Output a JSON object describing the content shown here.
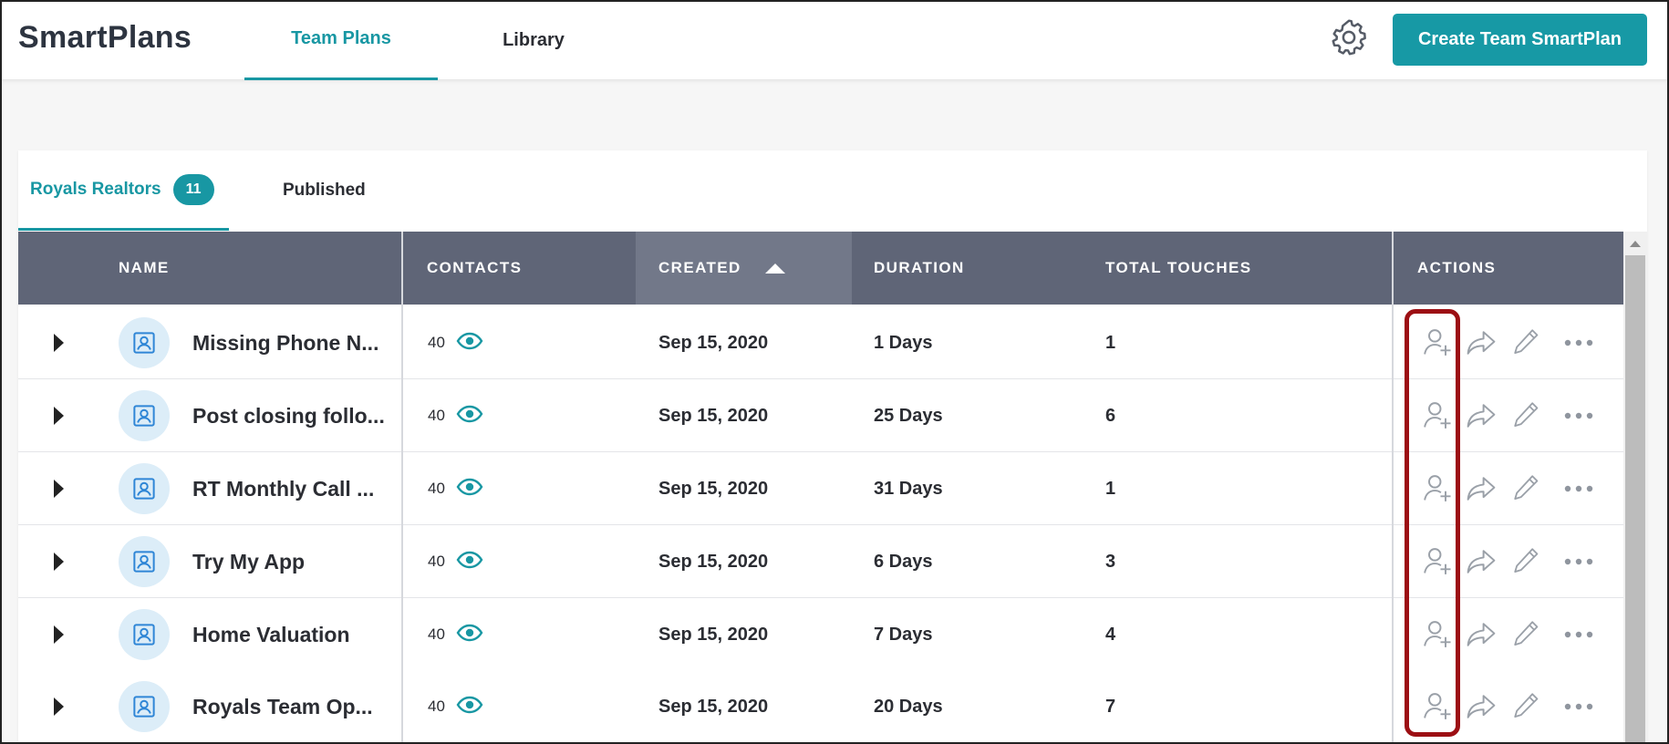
{
  "app": {
    "title": "SmartPlans"
  },
  "nav": {
    "tabs": [
      {
        "label": "Team Plans",
        "active": true
      },
      {
        "label": "Library",
        "active": false
      }
    ],
    "settings_icon": "gear-icon",
    "create_button": "Create Team SmartPlan"
  },
  "subtabs": {
    "primary": {
      "label": "Royals Realtors",
      "count": "11"
    },
    "secondary": {
      "label": "Published"
    }
  },
  "table": {
    "columns": {
      "name": "NAME",
      "contacts": "CONTACTS",
      "created": "CREATED",
      "duration": "DURATION",
      "total_touches": "TOTAL TOUCHES",
      "actions": "ACTIONS"
    },
    "sorted_column": "created",
    "sort_direction": "ascending",
    "rows": [
      {
        "name": "Missing Phone N...",
        "contacts": "40",
        "created": "Sep 15, 2020",
        "duration": "1 Days",
        "touches": "1"
      },
      {
        "name": "Post closing follo...",
        "contacts": "40",
        "created": "Sep 15, 2020",
        "duration": "25 Days",
        "touches": "6"
      },
      {
        "name": "RT Monthly Call ...",
        "contacts": "40",
        "created": "Sep 15, 2020",
        "duration": "31 Days",
        "touches": "1"
      },
      {
        "name": "Try My App",
        "contacts": "40",
        "created": "Sep 15, 2020",
        "duration": "6 Days",
        "touches": "3"
      },
      {
        "name": "Home Valuation",
        "contacts": "40",
        "created": "Sep 15, 2020",
        "duration": "7 Days",
        "touches": "4"
      },
      {
        "name": "Royals Team Op...",
        "contacts": "40",
        "created": "Sep 15, 2020",
        "duration": "20 Days",
        "touches": "7"
      }
    ],
    "row_actions": [
      "add-contact-icon",
      "share-icon",
      "edit-icon",
      "more-options-icon"
    ]
  },
  "colors": {
    "accent": "#1897a3",
    "header_bg": "#5f6577",
    "highlight": "#9c0f14"
  }
}
